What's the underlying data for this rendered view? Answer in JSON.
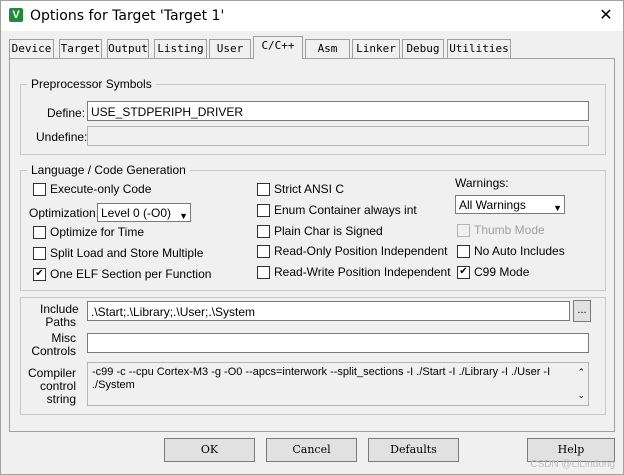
{
  "window": {
    "title": "Options for Target 'Target 1'",
    "app_icon_glyph": "V"
  },
  "tabs": [
    "Device",
    "Target",
    "Output",
    "Listing",
    "User",
    "C/C++",
    "Asm",
    "Linker",
    "Debug",
    "Utilities"
  ],
  "active_tab": "C/C++",
  "preprocessor": {
    "legend": "Preprocessor Symbols",
    "define_label": "Define:",
    "define_value": "USE_STDPERIPH_DRIVER",
    "undefine_label": "Undefine:",
    "undefine_value": ""
  },
  "language": {
    "legend": "Language / Code Generation",
    "execute_only": "Execute-only Code",
    "optimization_label": "Optimization:",
    "optimization_value": "Level 0 (-O0)",
    "optimize_time": "Optimize for Time",
    "split_load": "Split Load and Store Multiple",
    "one_elf": "One ELF Section per Function",
    "strict_ansi": "Strict ANSI C",
    "enum_container": "Enum Container always int",
    "plain_char": "Plain Char is Signed",
    "ro_pos": "Read-Only Position Independent",
    "rw_pos": "Read-Write Position Independent",
    "warnings_label": "Warnings:",
    "warnings_value": "All Warnings",
    "thumb_mode": "Thumb Mode",
    "no_auto": "No Auto Includes",
    "c99": "C99 Mode",
    "check_mark": "✔"
  },
  "include": {
    "include_label_1": "Include",
    "include_label_2": "Paths",
    "include_value": ".\\Start;.\\Library;.\\User;.\\System",
    "browse_label": "...",
    "misc_label_1": "Misc",
    "misc_label_2": "Controls",
    "misc_value": "",
    "compiler_label_1": "Compiler",
    "compiler_label_2": "control",
    "compiler_label_3": "string",
    "compiler_line_1": "-c99 -c --cpu Cortex-M3 -g -O0 --apcs=interwork --split_sections -I ./Start -I ./Library -I ./User -I",
    "compiler_line_2": "./System"
  },
  "buttons": {
    "ok": "OK",
    "cancel": "Cancel",
    "defaults": "Defaults",
    "help": "Help"
  },
  "watermark": "CSDN @LiLindong"
}
